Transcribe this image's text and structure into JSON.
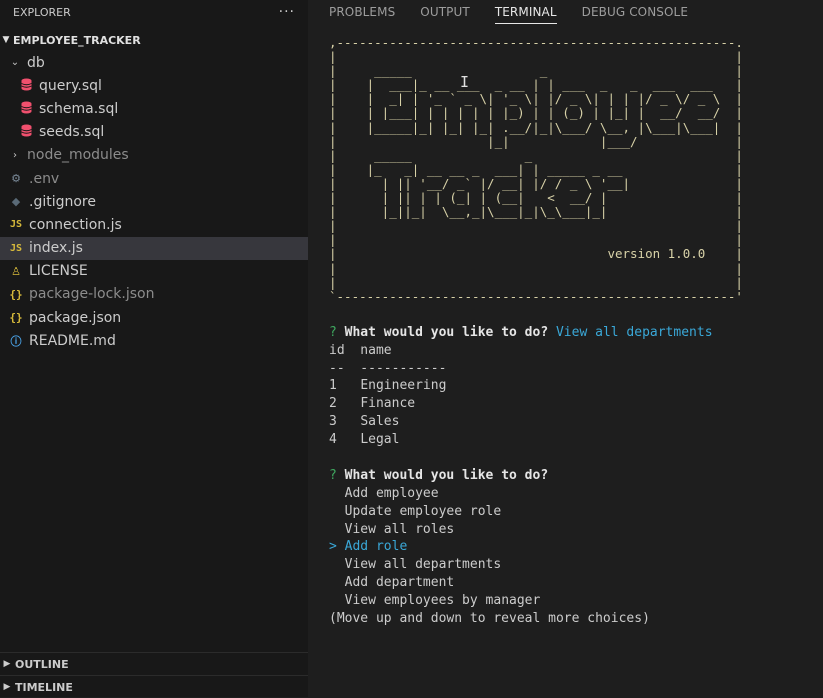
{
  "explorer": {
    "title": "EXPLORER",
    "more": "···",
    "project": "EMPLOYEE_TRACKER",
    "items": [
      {
        "label": "db",
        "kind": "folder-open",
        "icon": "chevron-down-icon",
        "indent": 0
      },
      {
        "label": "query.sql",
        "kind": "file",
        "icon": "database-icon",
        "indent": 1
      },
      {
        "label": "schema.sql",
        "kind": "file",
        "icon": "database-icon",
        "indent": 1
      },
      {
        "label": "seeds.sql",
        "kind": "file",
        "icon": "database-icon",
        "indent": 1
      },
      {
        "label": "node_modules",
        "kind": "folder-closed",
        "icon": "chevron-right-icon",
        "indent": 0
      },
      {
        "label": ".env",
        "kind": "file",
        "icon": "gear-icon",
        "indent": 0
      },
      {
        "label": ".gitignore",
        "kind": "file",
        "icon": "git-icon",
        "indent": 0
      },
      {
        "label": "connection.js",
        "kind": "file",
        "icon": "js-icon",
        "indent": 0
      },
      {
        "label": "index.js",
        "kind": "file",
        "icon": "js-icon",
        "indent": 0
      },
      {
        "label": "LICENSE",
        "kind": "file",
        "icon": "license-icon",
        "indent": 0
      },
      {
        "label": "package-lock.json",
        "kind": "file",
        "icon": "json-icon",
        "indent": 0
      },
      {
        "label": "package.json",
        "kind": "file",
        "icon": "json-icon",
        "indent": 0
      },
      {
        "label": "README.md",
        "kind": "file",
        "icon": "info-icon",
        "indent": 0
      }
    ],
    "outline": "OUTLINE",
    "timeline": "TIMELINE"
  },
  "panel": {
    "tabs": [
      "PROBLEMS",
      "OUTPUT",
      "TERMINAL",
      "DEBUG CONSOLE"
    ],
    "active_tab": "TERMINAL"
  },
  "terminal": {
    "banner": ",-----------------------------------------------------.\n|                                                     |\n|     _____                 _                         |\n|    |  ___|_ __ ___  _ __ | | ___  _   _  ___  ___   |\n|    |  _| | '_ ` _ \\| '_ \\| |/ _ \\| | | |/ _ \\/ _ \\  |\n|    | |___| | | | | | |_) | | (_) | |_| |  __/  __/  |\n|    |_____|_| |_| |_| .__/|_|\\___/ \\__, |\\___|\\___|  |\n|                    |_|            |___/             |\n|     _____               _                           |\n|    |_   _| __ __ _  ___| | _____ _ __               |\n|      | || '__/ _` |/ __| |/ / _ \\ '__|              |\n|      | || | | (_| | (__|   <  __/ |                 |\n|      |_||_|  \\__,_|\\___|_|\\_\\___|_|                 |\n|                                                     |\n|                                                     |\n|                                    version 1.0.0    |\n|                                                     |\n|                                                     |\n`-----------------------------------------------------'",
    "prompt_mark": "?",
    "question": "What would you like to do?",
    "first_answer": "View all departments",
    "table_header": "id  name",
    "table_rule": "--  -----------",
    "rows": [
      {
        "id": "1",
        "name": "Engineering"
      },
      {
        "id": "2",
        "name": "Finance"
      },
      {
        "id": "3",
        "name": "Sales"
      },
      {
        "id": "4",
        "name": "Legal"
      }
    ],
    "choices": [
      {
        "label": "Add employee",
        "selected": false
      },
      {
        "label": "Update employee role",
        "selected": false
      },
      {
        "label": "View all roles",
        "selected": false
      },
      {
        "label": "Add role",
        "selected": true
      },
      {
        "label": "View all departments",
        "selected": false
      },
      {
        "label": "Add department",
        "selected": false
      },
      {
        "label": "View employees by manager",
        "selected": false
      }
    ],
    "pointer": ">",
    "hint": "(Move up and down to reveal more choices)",
    "cursor": "I"
  },
  "colors": {
    "sidebar_bg": "#181818",
    "panel_bg": "#1e1e1e",
    "active_row": "#37373d",
    "accent_cyan": "#3aa8d8",
    "prompt_green": "#3fa75f",
    "sql_icon": "#f0506e",
    "banner_text": "#d8d2a8"
  }
}
